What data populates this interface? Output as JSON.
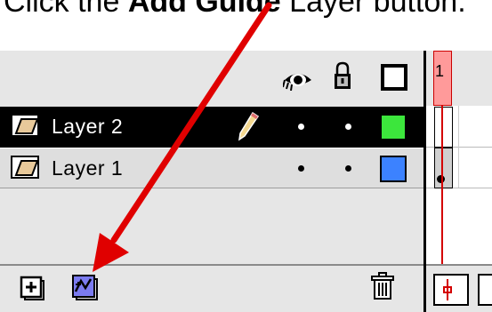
{
  "caption": {
    "prefix": "Click the ",
    "bold": "Add Guide",
    "suffix": " Layer button."
  },
  "layers": [
    {
      "name": "Layer 2",
      "selected": true,
      "color": "#3ce63c"
    },
    {
      "name": "Layer 1",
      "selected": false,
      "color": "#3c82ff"
    }
  ],
  "timeline": {
    "frame_label": "1"
  },
  "icons": {
    "header": [
      "eye-icon",
      "lock-icon",
      "outline-icon"
    ],
    "bottom": [
      "add-layer-icon",
      "add-guide-layer-icon",
      "trash-icon"
    ]
  },
  "colors": {
    "playhead": "#d40000",
    "arrow": "#e00000"
  }
}
